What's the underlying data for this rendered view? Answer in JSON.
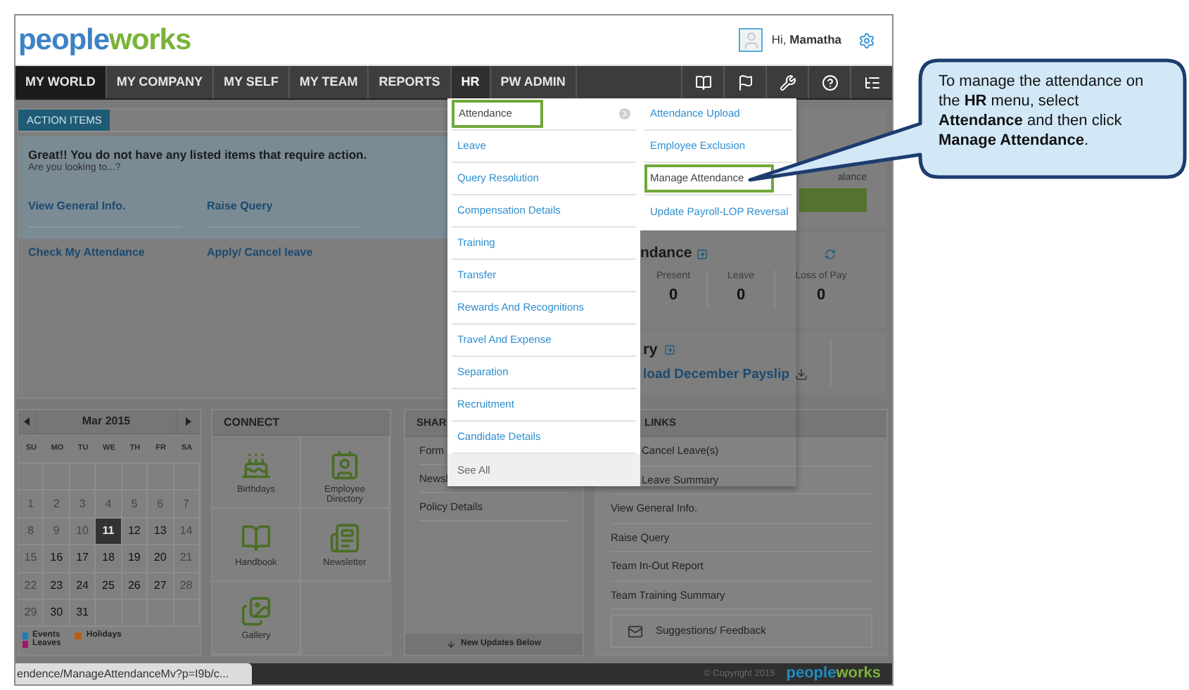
{
  "header": {
    "logo": [
      {
        "text": "people",
        "color": "#3d82c4"
      },
      {
        "text": "works",
        "color": "#7bb33a"
      }
    ],
    "greeting": "Hi, **Mamatha**"
  },
  "nav": {
    "items": [
      {
        "label": "MY WORLD",
        "selected": true,
        "open": false
      },
      {
        "label": "MY COMPANY",
        "selected": false,
        "open": false
      },
      {
        "label": "MY SELF",
        "selected": false,
        "open": false
      },
      {
        "label": "MY TEAM",
        "selected": false,
        "open": false
      },
      {
        "label": "REPORTS",
        "selected": false,
        "open": false
      },
      {
        "label": "HR",
        "selected": false,
        "open": true
      },
      {
        "label": "PW ADMIN",
        "selected": false,
        "open": false
      }
    ]
  },
  "action_items": {
    "tab": "ACTION ITEMS",
    "message": "Great!! You do not have any listed items that require action.",
    "prompt": "Are you looking to...?",
    "links": [
      "View General Info.",
      "Raise Query",
      "Check My Attendance",
      "Apply/ Cancel leave"
    ]
  },
  "leave_balance": {
    "title": "alance"
  },
  "attendance": {
    "title": "ndance",
    "stats": [
      {
        "label": "Present",
        "value": "0"
      },
      {
        "label": "Leave",
        "value": "0"
      },
      {
        "label": "Loss of Pay",
        "value": "0"
      }
    ]
  },
  "salary": {
    "title": "ry",
    "link": "load December Payslip"
  },
  "calendar": {
    "month": "Mar 2015",
    "weekdays": [
      "SU",
      "MO",
      "TU",
      "WE",
      "TH",
      "FR",
      "SA"
    ],
    "weeks": [
      [
        {
          "kind": "empty"
        },
        {
          "kind": "empty"
        },
        {
          "kind": "empty"
        },
        {
          "kind": "empty"
        },
        {
          "kind": "empty"
        },
        {
          "kind": "empty"
        },
        {
          "kind": "empty"
        }
      ],
      [
        {
          "day": "1",
          "muted": true,
          "today": false
        },
        {
          "day": "2",
          "muted": true,
          "today": false
        },
        {
          "day": "3",
          "muted": true,
          "today": false
        },
        {
          "day": "4",
          "muted": true,
          "today": false
        },
        {
          "day": "5",
          "muted": true,
          "today": false
        },
        {
          "day": "6",
          "muted": true,
          "today": false
        },
        {
          "day": "7",
          "muted": true,
          "today": false
        }
      ],
      [
        {
          "day": "8",
          "muted": true,
          "today": false
        },
        {
          "day": "9",
          "muted": true,
          "today": false
        },
        {
          "day": "10",
          "muted": true,
          "today": false
        },
        {
          "day": "11",
          "muted": false,
          "today": true
        },
        {
          "day": "12",
          "muted": false,
          "today": false
        },
        {
          "day": "13",
          "muted": false,
          "today": false
        },
        {
          "day": "14",
          "muted": true,
          "today": false
        }
      ],
      [
        {
          "day": "15",
          "muted": true,
          "today": false
        },
        {
          "day": "16",
          "muted": false,
          "today": false
        },
        {
          "day": "17",
          "muted": false,
          "today": false
        },
        {
          "day": "18",
          "muted": false,
          "today": false
        },
        {
          "day": "19",
          "muted": false,
          "today": false
        },
        {
          "day": "20",
          "muted": false,
          "today": false
        },
        {
          "day": "21",
          "muted": true,
          "today": false
        }
      ],
      [
        {
          "day": "22",
          "muted": true,
          "today": false
        },
        {
          "day": "23",
          "muted": false,
          "today": false
        },
        {
          "day": "24",
          "muted": false,
          "today": false
        },
        {
          "day": "25",
          "muted": false,
          "today": false
        },
        {
          "day": "26",
          "muted": false,
          "today": false
        },
        {
          "day": "27",
          "muted": false,
          "today": false
        },
        {
          "day": "28",
          "muted": true,
          "today": false
        }
      ],
      [
        {
          "day": "29",
          "muted": true,
          "today": false
        },
        {
          "day": "30",
          "muted": false,
          "today": false
        },
        {
          "day": "31",
          "muted": false,
          "today": false
        },
        {
          "kind": "empty"
        },
        {
          "kind": "empty"
        },
        {
          "kind": "empty"
        },
        {
          "kind": "empty"
        }
      ]
    ],
    "legend": [
      {
        "label": "Events",
        "color": "#1a7fb8"
      },
      {
        "label": "Leaves",
        "color": "#a3146c"
      },
      {
        "label": "Holidays",
        "color": "#b85e12"
      }
    ]
  },
  "connect": {
    "title": "CONNECT",
    "items": [
      {
        "label": "Birthdays",
        "kind": "cake"
      },
      {
        "label": "Employee Directory",
        "kind": "directory"
      },
      {
        "label": "Handbook",
        "kind": "book"
      },
      {
        "label": "Newsletter",
        "kind": "news"
      },
      {
        "label": "Gallery",
        "kind": "gallery"
      }
    ]
  },
  "shared": {
    "title": "SHAR",
    "items": [
      "Form",
      "Newsl",
      "Policy Details"
    ],
    "footer": "New Updates Below"
  },
  "quick_links": {
    "title": "LINKS",
    "items": [
      "Cancel Leave(s)",
      "Leave Summary",
      "View General Info.",
      "Raise Query",
      "Team In-Out Report",
      "Team Training Summary"
    ],
    "feedback": "Suggestions/ Feedback"
  },
  "hr_menu": {
    "items": [
      {
        "label": "Attendance",
        "selected": true
      },
      {
        "label": "Leave",
        "selected": false
      },
      {
        "label": "Query Resolution",
        "selected": false
      },
      {
        "label": "Compensation Details",
        "selected": false
      },
      {
        "label": "Training",
        "selected": false
      },
      {
        "label": "Transfer",
        "selected": false
      },
      {
        "label": "Rewards And Recognitions",
        "selected": false
      },
      {
        "label": "Travel And Expense",
        "selected": false
      },
      {
        "label": "Separation",
        "selected": false
      },
      {
        "label": "Recruitment",
        "selected": false
      },
      {
        "label": "Candidate Details",
        "selected": false
      }
    ],
    "see_all": "See All",
    "submenu": [
      {
        "label": "Attendance Upload",
        "selected": false
      },
      {
        "label": "Employee Exclusion",
        "selected": false
      },
      {
        "label": "Manage Attendance",
        "selected": true
      },
      {
        "label": "Update Payroll-LOP Reversal",
        "selected": false
      }
    ]
  },
  "status_bar": {
    "url": "endence/ManageAttendanceMv?p=I9b/c...",
    "copyright": "© Copyright 2015",
    "logo": [
      {
        "text": "people",
        "color": "#1f8cc4"
      },
      {
        "text": "works",
        "color": "#7bb33a"
      }
    ]
  },
  "callout": {
    "text": "To manage the attendance on the **HR** menu, select **Attendance** and then click **Manage Attendance**."
  }
}
